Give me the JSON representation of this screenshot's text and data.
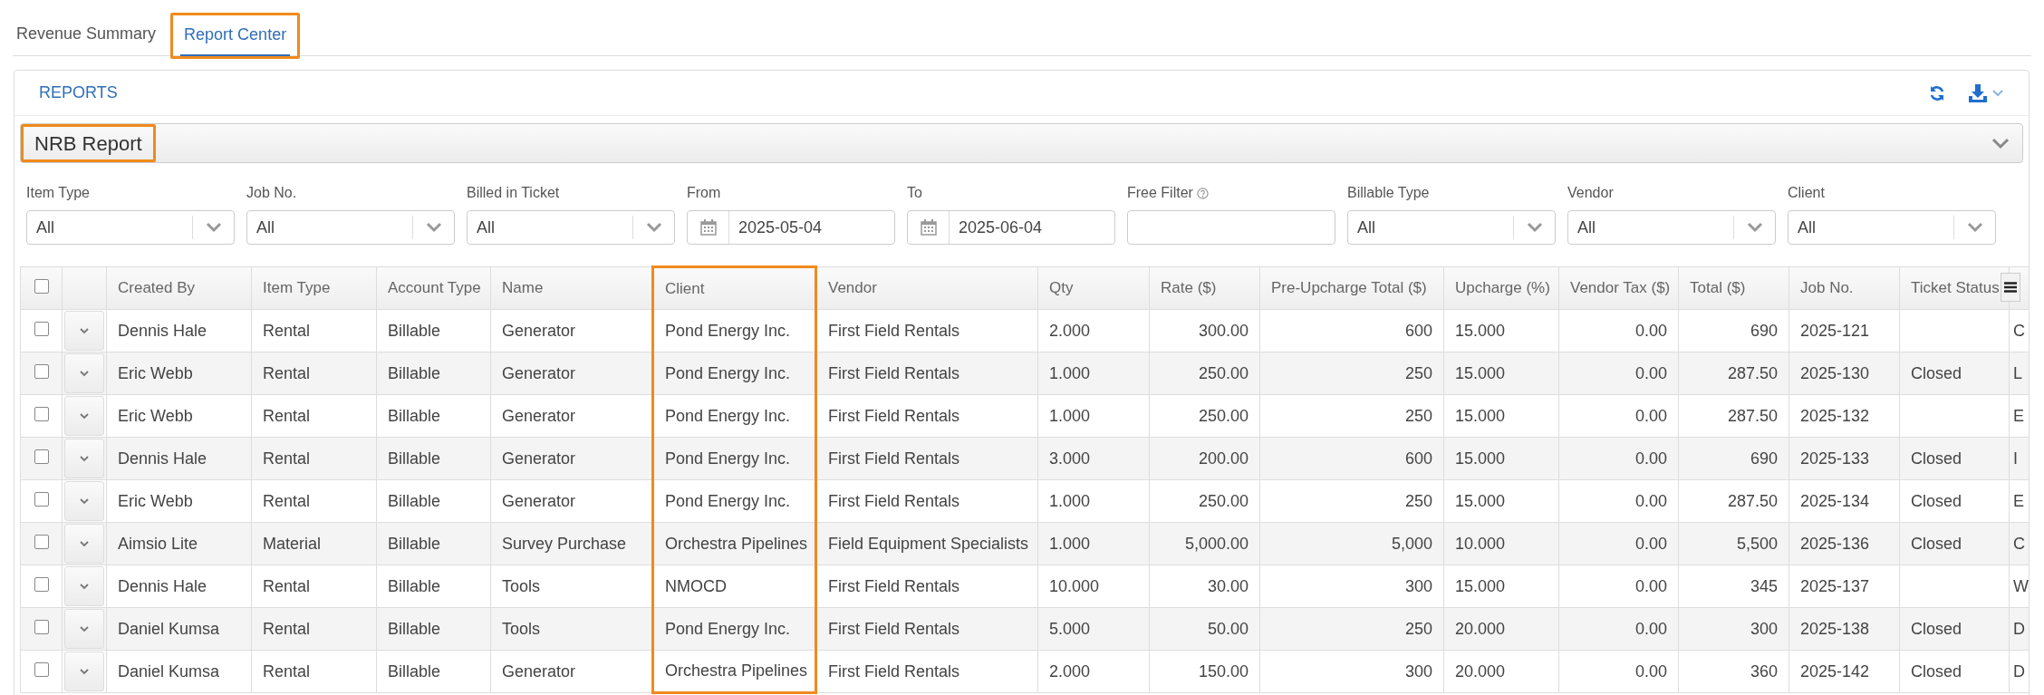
{
  "tabs": [
    {
      "label": "Revenue Summary",
      "selected": false,
      "highlighted": false
    },
    {
      "label": "Report Center",
      "selected": true,
      "highlighted": true
    }
  ],
  "panel": {
    "title": "REPORTS",
    "report_selector": {
      "value": "NRB Report",
      "highlighted": true
    },
    "filters": [
      {
        "label": "Item Type",
        "kind": "select",
        "value": "All"
      },
      {
        "label": "Job No.",
        "kind": "select",
        "value": "All"
      },
      {
        "label": "Billed in Ticket",
        "kind": "select",
        "value": "All"
      },
      {
        "label": "From",
        "kind": "date",
        "value": "2025-05-04"
      },
      {
        "label": "To",
        "kind": "date",
        "value": "2025-06-04"
      },
      {
        "label": "Free Filter",
        "kind": "text",
        "help": true
      },
      {
        "label": "Billable Type",
        "kind": "select",
        "value": "All"
      },
      {
        "label": "Vendor",
        "kind": "select",
        "value": "All"
      },
      {
        "label": "Client",
        "kind": "select",
        "value": "All"
      }
    ],
    "table": {
      "all_checked": false,
      "columns": [
        {
          "label": "Created By",
          "kind": "text",
          "highlighted": false
        },
        {
          "label": "Item Type",
          "kind": "text",
          "highlighted": false
        },
        {
          "label": "Account Type",
          "kind": "text",
          "highlighted": false
        },
        {
          "label": "Name",
          "kind": "text",
          "highlighted": false
        },
        {
          "label": "Client",
          "kind": "text",
          "highlighted": true
        },
        {
          "label": "Vendor",
          "kind": "text",
          "highlighted": false
        },
        {
          "label": "Qty",
          "kind": "text",
          "highlighted": false
        },
        {
          "label": "Rate ($)",
          "kind": "amount",
          "highlighted": false
        },
        {
          "label": "Pre-Upcharge Total ($)",
          "kind": "amount",
          "highlighted": false
        },
        {
          "label": "Upcharge (%)",
          "kind": "text",
          "highlighted": false
        },
        {
          "label": "Vendor Tax ($)",
          "kind": "amount",
          "highlighted": false
        },
        {
          "label": "Total ($)",
          "kind": "amount",
          "highlighted": false
        },
        {
          "label": "Job No.",
          "kind": "text",
          "highlighted": false
        },
        {
          "label": "Ticket Status",
          "kind": "text",
          "highlighted": false
        },
        {
          "kind": "text",
          "highlighted": false
        }
      ],
      "rows": [
        {
          "checked": false,
          "cells": [
            "Dennis Hale",
            "Rental",
            "Billable",
            "Generator",
            "Pond Energy Inc.",
            "First Field Rentals",
            "2.000",
            "300.00",
            "600",
            "15.000",
            "0.00",
            "690",
            "2025-121",
            "",
            "C"
          ]
        },
        {
          "checked": false,
          "cells": [
            "Eric Webb",
            "Rental",
            "Billable",
            "Generator",
            "Pond Energy Inc.",
            "First Field Rentals",
            "1.000",
            "250.00",
            "250",
            "15.000",
            "0.00",
            "287.50",
            "2025-130",
            "Closed",
            "L"
          ]
        },
        {
          "checked": false,
          "cells": [
            "Eric Webb",
            "Rental",
            "Billable",
            "Generator",
            "Pond Energy Inc.",
            "First Field Rentals",
            "1.000",
            "250.00",
            "250",
            "15.000",
            "0.00",
            "287.50",
            "2025-132",
            "",
            "E"
          ]
        },
        {
          "checked": false,
          "cells": [
            "Dennis Hale",
            "Rental",
            "Billable",
            "Generator",
            "Pond Energy Inc.",
            "First Field Rentals",
            "3.000",
            "200.00",
            "600",
            "15.000",
            "0.00",
            "690",
            "2025-133",
            "Closed",
            "I"
          ]
        },
        {
          "checked": false,
          "cells": [
            "Eric Webb",
            "Rental",
            "Billable",
            "Generator",
            "Pond Energy Inc.",
            "First Field Rentals",
            "1.000",
            "250.00",
            "250",
            "15.000",
            "0.00",
            "287.50",
            "2025-134",
            "Closed",
            "E"
          ]
        },
        {
          "checked": false,
          "cells": [
            "Aimsio Lite",
            "Material",
            "Billable",
            "Survey Purchase",
            "Orchestra Pipelines",
            "Field Equipment Specialists",
            "1.000",
            "5,000.00",
            "5,000",
            "10.000",
            "0.00",
            "5,500",
            "2025-136",
            "Closed",
            "C"
          ]
        },
        {
          "checked": false,
          "cells": [
            "Dennis Hale",
            "Rental",
            "Billable",
            "Tools",
            "NMOCD",
            "First Field Rentals",
            "10.000",
            "30.00",
            "300",
            "15.000",
            "0.00",
            "345",
            "2025-137",
            "",
            "W"
          ]
        },
        {
          "checked": false,
          "cells": [
            "Daniel Kumsa",
            "Rental",
            "Billable",
            "Tools",
            "Pond Energy Inc.",
            "First Field Rentals",
            "5.000",
            "50.00",
            "250",
            "20.000",
            "0.00",
            "300",
            "2025-138",
            "Closed",
            "D"
          ]
        },
        {
          "checked": false,
          "cells": [
            "Daniel Kumsa",
            "Rental",
            "Billable",
            "Generator",
            "Orchestra Pipelines",
            "First Field Rentals",
            "2.000",
            "150.00",
            "300",
            "20.000",
            "0.00",
            "360",
            "2025-142",
            "Closed",
            "D"
          ]
        }
      ]
    }
  }
}
